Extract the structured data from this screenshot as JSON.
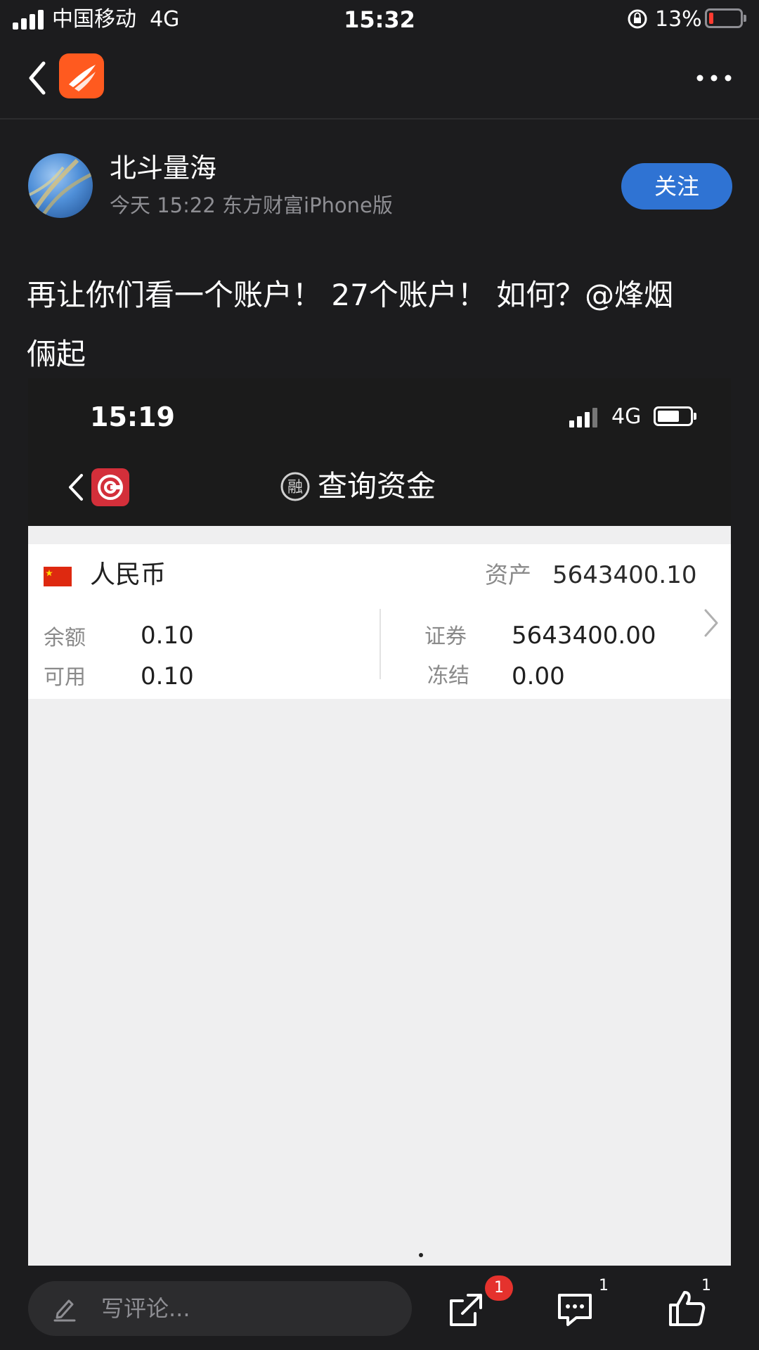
{
  "status_bar": {
    "carrier": "中国移动",
    "network": "4G",
    "time": "15:32",
    "battery_percent": "13%",
    "battery_color": "#ff3b30"
  },
  "nav": {
    "back_icon": "chevron-left-icon",
    "app_logo": "app-logo",
    "more_icon": "more-dots-icon"
  },
  "post": {
    "author": "北斗量海",
    "meta": "今天 15:22 东方财富iPhone版",
    "follow_label": "关注",
    "text_line1": "再让你们看一个账户！ 27个账户！ 如何？@烽烟",
    "text_line2": "倆起"
  },
  "embedded": {
    "time": "15:19",
    "network": "4G",
    "title": "查询资金",
    "title_icon_char": "融",
    "currency": "人民币",
    "asset_label": "资产",
    "asset_value": "5643400.10",
    "balance_label": "余额",
    "balance_value": "0.10",
    "available_label": "可用",
    "available_value": "0.10",
    "securities_label": "证券",
    "securities_value": "5643400.00",
    "frozen_label": "冻结",
    "frozen_value": "0.00"
  },
  "bottom_bar": {
    "comment_placeholder": "写评论...",
    "share_badge": "1",
    "comment_count": "1",
    "like_count": "1"
  },
  "colors": {
    "background": "#1c1c1e",
    "accent": "#2f73d3",
    "badge": "#e5322d",
    "app_logo": "#ff5a1f"
  }
}
